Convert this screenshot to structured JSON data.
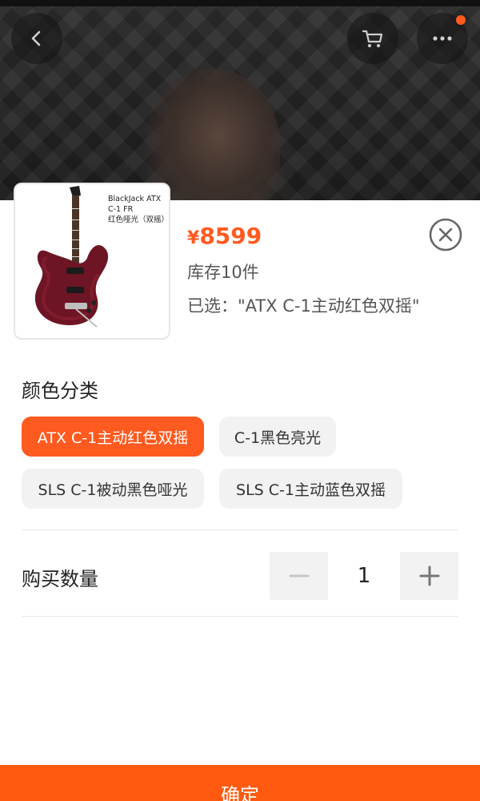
{
  "product": {
    "thumb_lines": [
      "BlackJack ATX",
      "C-1 FR",
      "红色哑光（双摇）"
    ],
    "price_symbol": "¥",
    "price": "8599",
    "stock": "库存10件",
    "selected": "已选：\"ATX C-1主动红色双摇\""
  },
  "color_section": {
    "title": "颜色分类",
    "options": [
      {
        "label": "ATX C-1主动红色双摇",
        "selected": true
      },
      {
        "label": "C-1黑色亮光",
        "selected": false
      },
      {
        "label": "SLS C-1被动黑色哑光",
        "selected": false
      },
      {
        "label": "SLS C-1主动蓝色双摇",
        "selected": false
      }
    ]
  },
  "quantity": {
    "label": "购买数量",
    "value": "1"
  },
  "confirm_label": "确定",
  "icons": {
    "back": "chevron-left-icon",
    "cart": "cart-icon",
    "more": "more-dots-icon",
    "close": "close-circle-icon",
    "minus": "minus-icon",
    "plus": "plus-icon"
  },
  "colors": {
    "accent": "#ff5a1f",
    "chip_bg": "#f2f2f2",
    "confirm_bg": "#ff5a0f"
  }
}
